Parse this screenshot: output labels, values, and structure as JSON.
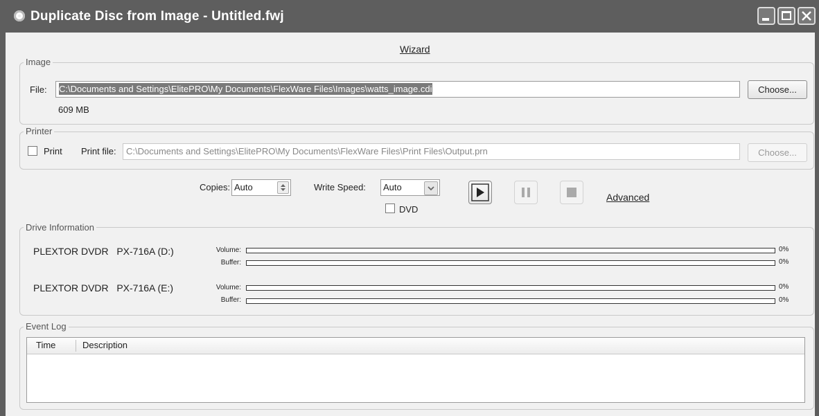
{
  "window": {
    "title": "Duplicate Disc from Image - Untitled.fwj",
    "icon": "disc-icon",
    "controls": [
      "minimize-icon",
      "maximize-icon",
      "close-icon"
    ]
  },
  "wizard_link": "Wizard",
  "image_group": {
    "label": "Image",
    "file_label": "File:",
    "file_value": "C:\\Documents and Settings\\ElitePRO\\My Documents\\FlexWare Files\\Images\\watts_image.cdi",
    "choose_label": "Choose...",
    "size": "609 MB"
  },
  "printer_group": {
    "label": "Printer",
    "print_label": "Print",
    "print_checked": false,
    "print_file_label": "Print file:",
    "print_file_value": "C:\\Documents and Settings\\ElitePRO\\My Documents\\FlexWare Files\\Print Files\\Output.prn",
    "choose_label": "Choose..."
  },
  "controls": {
    "copies_label": "Copies:",
    "copies_value": "Auto",
    "write_speed_label": "Write Speed:",
    "write_speed_value": "Auto",
    "dvd_label": "DVD",
    "dvd_checked": false,
    "advanced_label": "Advanced",
    "buttons": [
      "play-icon",
      "pause-icon",
      "stop-icon"
    ]
  },
  "drive_info": {
    "label": "Drive Information",
    "volume_label": "Volume:",
    "buffer_label": "Buffer:",
    "drives": [
      {
        "name": "PLEXTOR DVDR   PX-716A (D:)",
        "volume_pct": 0,
        "volume_text": "0%",
        "buffer_pct": 0,
        "buffer_text": "0%"
      },
      {
        "name": "PLEXTOR DVDR   PX-716A (E:)",
        "volume_pct": 0,
        "volume_text": "0%",
        "buffer_pct": 0,
        "buffer_text": "0%"
      }
    ]
  },
  "event_log": {
    "label": "Event Log",
    "columns": [
      "Time",
      "Description"
    ],
    "rows": []
  }
}
